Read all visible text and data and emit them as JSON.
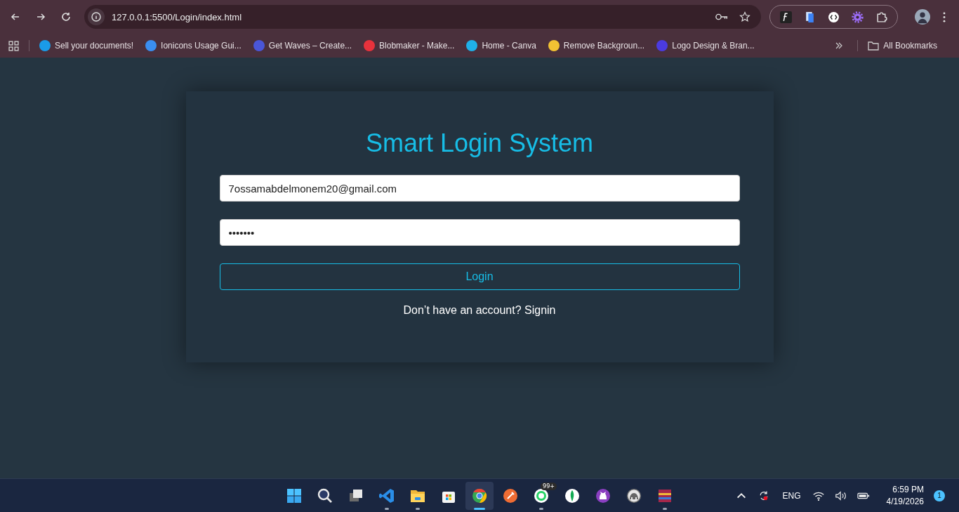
{
  "browser": {
    "url": "127.0.0.1:5500/Login/index.html",
    "bookmarks": [
      {
        "label": "Sell your documents!",
        "color": "#1a9be8"
      },
      {
        "label": "Ionicons Usage Gui...",
        "color": "#3a8ef0"
      },
      {
        "label": "Get Waves – Create...",
        "color": "#4a56d8"
      },
      {
        "label": "Blobmaker - Make...",
        "color": "#e8323c"
      },
      {
        "label": "Home - Canva",
        "color": "#1fb0e8"
      },
      {
        "label": "Remove Backgroun...",
        "color": "#f2c233"
      },
      {
        "label": "Logo Design & Bran...",
        "color": "#4b3be0"
      }
    ],
    "all_bookmarks": "All Bookmarks"
  },
  "form": {
    "title": "Smart Login System",
    "email": "7ossamabdelmonem20@gmail.com",
    "password": "•••••••",
    "button": "Login",
    "prompt": "Don’t have an account? Signin"
  },
  "taskbar": {
    "apps": [
      {
        "kind": "start",
        "open": false,
        "selected": false
      },
      {
        "kind": "search",
        "open": false,
        "selected": false
      },
      {
        "kind": "taskview",
        "open": false,
        "selected": false
      },
      {
        "kind": "vscode",
        "open": true,
        "selected": false
      },
      {
        "kind": "folder",
        "open": true,
        "selected": false
      },
      {
        "kind": "store",
        "open": false,
        "selected": false
      },
      {
        "kind": "chrome",
        "open": true,
        "selected": true
      },
      {
        "kind": "postman",
        "open": false,
        "selected": false
      },
      {
        "kind": "whatsapp",
        "open": true,
        "selected": false,
        "badge": "99+"
      },
      {
        "kind": "mongodb",
        "open": false,
        "selected": false
      },
      {
        "kind": "github",
        "open": false,
        "selected": false
      },
      {
        "kind": "mamp",
        "open": false,
        "selected": false
      },
      {
        "kind": "archive",
        "open": true,
        "selected": false
      }
    ],
    "language": "ENG",
    "time": "6:59 PM",
    "date": "4/19/2026",
    "notifications": "1"
  }
}
